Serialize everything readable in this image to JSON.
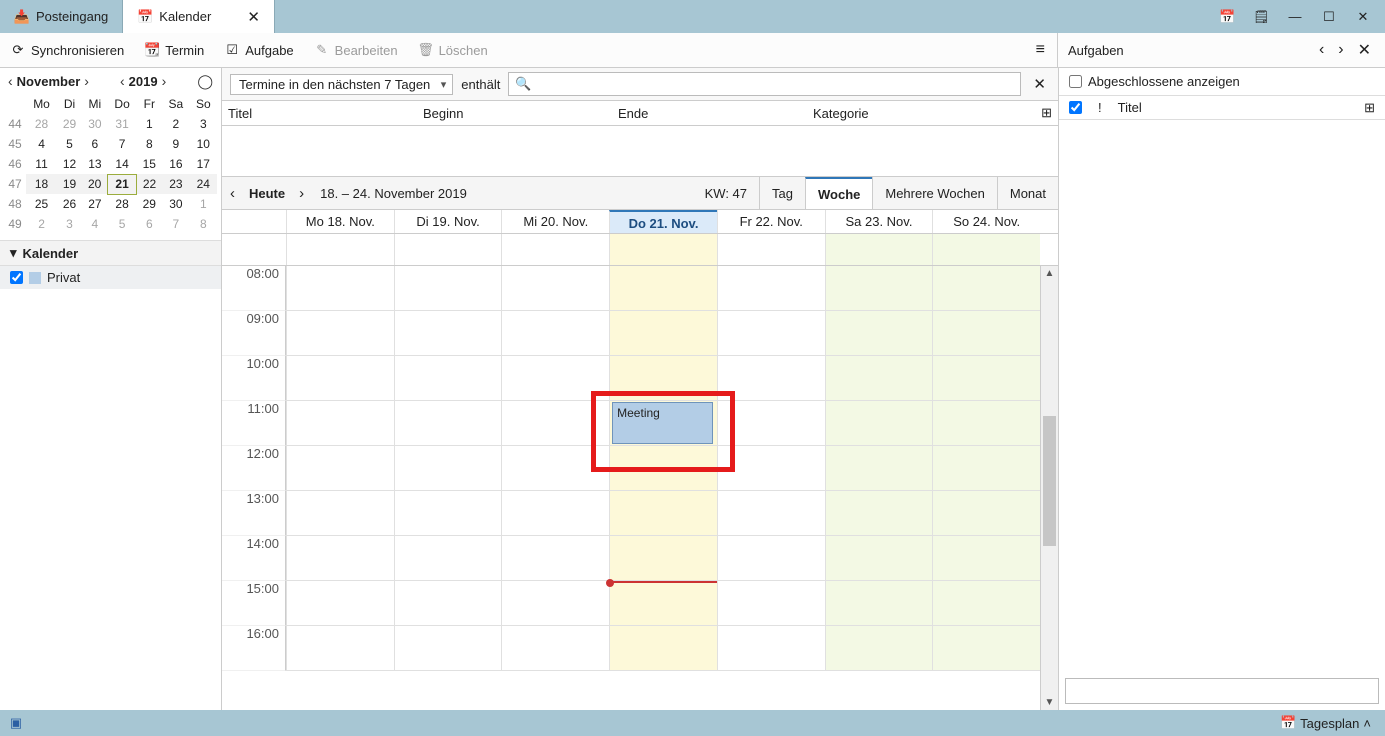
{
  "tabs": {
    "inbox": "Posteingang",
    "calendar": "Kalender"
  },
  "toolbar": {
    "sync": "Synchronisieren",
    "termin": "Termin",
    "aufgabe": "Aufgabe",
    "bearbeiten": "Bearbeiten",
    "loeschen": "Löschen"
  },
  "minical": {
    "month": "November",
    "year": "2019",
    "dow": [
      "Mo",
      "Di",
      "Mi",
      "Do",
      "Fr",
      "Sa",
      "So"
    ],
    "rows": [
      {
        "wk": "44",
        "days": [
          {
            "d": "28",
            "o": 1
          },
          {
            "d": "29",
            "o": 1
          },
          {
            "d": "30",
            "o": 1
          },
          {
            "d": "31",
            "o": 1
          },
          {
            "d": "1"
          },
          {
            "d": "2"
          },
          {
            "d": "3"
          }
        ]
      },
      {
        "wk": "45",
        "days": [
          {
            "d": "4"
          },
          {
            "d": "5"
          },
          {
            "d": "6"
          },
          {
            "d": "7"
          },
          {
            "d": "8"
          },
          {
            "d": "9"
          },
          {
            "d": "10"
          }
        ]
      },
      {
        "wk": "46",
        "days": [
          {
            "d": "11"
          },
          {
            "d": "12"
          },
          {
            "d": "13"
          },
          {
            "d": "14"
          },
          {
            "d": "15"
          },
          {
            "d": "16"
          },
          {
            "d": "17"
          }
        ]
      },
      {
        "wk": "47",
        "days": [
          {
            "d": "18"
          },
          {
            "d": "19"
          },
          {
            "d": "20"
          },
          {
            "d": "21",
            "t": 1
          },
          {
            "d": "22"
          },
          {
            "d": "23"
          },
          {
            "d": "24"
          }
        ],
        "hl": 1
      },
      {
        "wk": "48",
        "days": [
          {
            "d": "25"
          },
          {
            "d": "26"
          },
          {
            "d": "27"
          },
          {
            "d": "28"
          },
          {
            "d": "29"
          },
          {
            "d": "30"
          },
          {
            "d": "1",
            "o": 1
          }
        ]
      },
      {
        "wk": "49",
        "days": [
          {
            "d": "2",
            "o": 1
          },
          {
            "d": "3",
            "o": 1
          },
          {
            "d": "4",
            "o": 1
          },
          {
            "d": "5",
            "o": 1
          },
          {
            "d": "6",
            "o": 1
          },
          {
            "d": "7",
            "o": 1
          },
          {
            "d": "8",
            "o": 1
          }
        ]
      }
    ]
  },
  "sidebar": {
    "calendars_hd": "Kalender",
    "calendar_name": "Privat"
  },
  "filter": {
    "dropdown": "Termine in den nächsten 7 Tagen",
    "contains": "enthält",
    "placeholder": ""
  },
  "list_cols": {
    "titel": "Titel",
    "beginn": "Beginn",
    "ende": "Ende",
    "kategorie": "Kategorie"
  },
  "weeknav": {
    "heute": "Heute",
    "range": "18. – 24. November 2019",
    "kw": "KW: 47",
    "views": {
      "tag": "Tag",
      "woche": "Woche",
      "mehrere": "Mehrere Wochen",
      "monat": "Monat"
    }
  },
  "days": [
    "Mo 18. Nov.",
    "Di 19. Nov.",
    "Mi 20. Nov.",
    "Do 21. Nov.",
    "Fr 22. Nov.",
    "Sa 23. Nov.",
    "So 24. Nov."
  ],
  "hours": [
    "08:00",
    "09:00",
    "10:00",
    "11:00",
    "12:00",
    "13:00",
    "14:00",
    "15:00",
    "16:00"
  ],
  "event": {
    "title": "Meeting"
  },
  "right": {
    "title": "Aufgaben",
    "show_done": "Abgeschlossene anzeigen",
    "col_title": "Titel"
  },
  "statusbar": {
    "plan": "Tagesplan"
  }
}
